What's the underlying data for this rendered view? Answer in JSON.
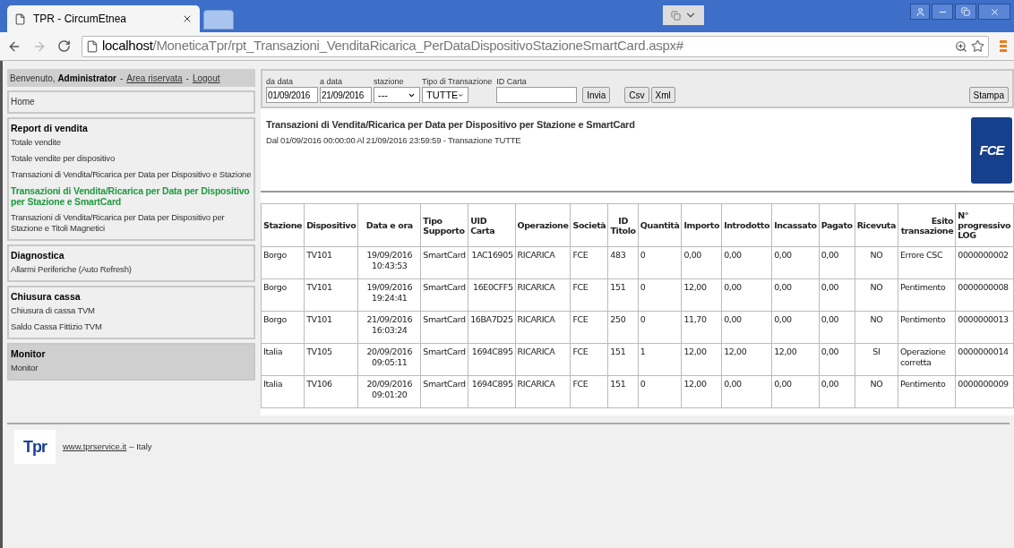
{
  "browser": {
    "tab_title": "TPR - CircumEtnea",
    "url_host": "localhost",
    "url_path": "/MoneticaTpr/rpt_Transazioni_VenditaRicarica_PerDataDispositivoStazioneSmartCard.aspx#"
  },
  "welcome": {
    "prefix": "Benvenuto,",
    "user": "Administrator",
    "separator_1": "-",
    "area_link": "Area riservata",
    "separator_2": "-",
    "logout_link": "Logout"
  },
  "sidebar": [
    {
      "title": "Home",
      "active": false
    },
    {
      "title": "Report di vendita",
      "active": false,
      "items": [
        {
          "label": "Totale vendite",
          "selected": false
        },
        {
          "label": "Totale vendite per dispositivo",
          "selected": false
        },
        {
          "label": "Transazioni di Vendita/Ricarica per Data per Dispositivo e Stazione",
          "selected": false
        },
        {
          "label": "Transazioni di Vendita/Ricarica per Data per Dispositivo per Stazione e SmartCard",
          "selected": true
        },
        {
          "label": "Transazioni di Vendita/Ricarica per Data per Dispositivo per Stazione e Titoli Magnetici",
          "selected": false
        }
      ]
    },
    {
      "title": "Diagnostica",
      "active": false,
      "items": [
        {
          "label": "Allarmi Periferiche (Auto Refresh)",
          "selected": false
        }
      ]
    },
    {
      "title": "Chiusura cassa",
      "active": false,
      "items": [
        {
          "label": "Chiusura di cassa TVM",
          "selected": false
        },
        {
          "label": "Saldo Cassa Fittizio TVM",
          "selected": false
        }
      ]
    },
    {
      "title": "Monitor",
      "active": true,
      "items": [
        {
          "label": "Monitor",
          "selected": false
        }
      ]
    }
  ],
  "filters": {
    "da_data": {
      "label": "da data",
      "value": "01/09/2016"
    },
    "a_data": {
      "label": "a data",
      "value": "21/09/2016"
    },
    "stazione": {
      "label": "stazione",
      "value": "---"
    },
    "tipo": {
      "label": "Tipo di Transazione",
      "value": "TUTTE"
    },
    "id_carta": {
      "label": "ID Carta"
    },
    "buttons": [
      "Invia",
      "Csv",
      "Xml"
    ],
    "print_button": "Stampa"
  },
  "report": {
    "title": "Transazioni di Vendita/Ricarica per Data per Dispositivo per Stazione e SmartCard",
    "subtitle": "Dal 01/09/2016 00:00:00 Al 21/09/2016 23:59:59 - Transazione TUTTE",
    "logo_text": "FCE"
  },
  "table": {
    "columns": [
      "Stazione",
      "Dispositivo",
      "Data e ora",
      "Tipo Supporto",
      "UID Carta",
      "Operazione",
      "Società",
      "ID Titolo",
      "Quantità",
      "Importo",
      "Introdotto",
      "Incassato",
      "Pagato",
      "Ricevuta",
      "Esito transazione",
      "N° progressivo LOG"
    ],
    "rows": [
      [
        "Borgo",
        "TV101",
        "19/09/2016 10:43:53",
        "SmartCard",
        "1AC16905",
        "RICARICA",
        "FCE",
        "483",
        "0",
        "0,00",
        "0,00",
        "0,00",
        "0,00",
        "NO",
        "Errore CSC",
        "0000000002"
      ],
      [
        "Borgo",
        "TV101",
        "19/09/2016 19:24:41",
        "SmartCard",
        "16E0CFF5",
        "RICARICA",
        "FCE",
        "151",
        "0",
        "12,00",
        "0,00",
        "0,00",
        "0,00",
        "NO",
        "Pentimento",
        "0000000008"
      ],
      [
        "Borgo",
        "TV101",
        "21/09/2016 16:03:24",
        "SmartCard",
        "16BA7D25",
        "RICARICA",
        "FCE",
        "250",
        "0",
        "11,70",
        "0,00",
        "0,00",
        "0,00",
        "NO",
        "Pentimento",
        "0000000013"
      ],
      [
        "Italia",
        "TV105",
        "20/09/2016 09:05:11",
        "SmartCard",
        "1694C895",
        "RICARICA",
        "FCE",
        "151",
        "1",
        "12,00",
        "12,00",
        "12,00",
        "0,00",
        "SI",
        "Operazione corretta",
        "0000000014"
      ],
      [
        "Italia",
        "TV106",
        "20/09/2016 09:01:20",
        "SmartCard",
        "1694C895",
        "RICARICA",
        "FCE",
        "151",
        "0",
        "12,00",
        "0,00",
        "0,00",
        "0,00",
        "NO",
        "Pentimento",
        "0000000009"
      ]
    ]
  },
  "footer": {
    "logo_text": "Tpr",
    "link": "www.tprservice.it",
    "suffix": "– Italy"
  }
}
